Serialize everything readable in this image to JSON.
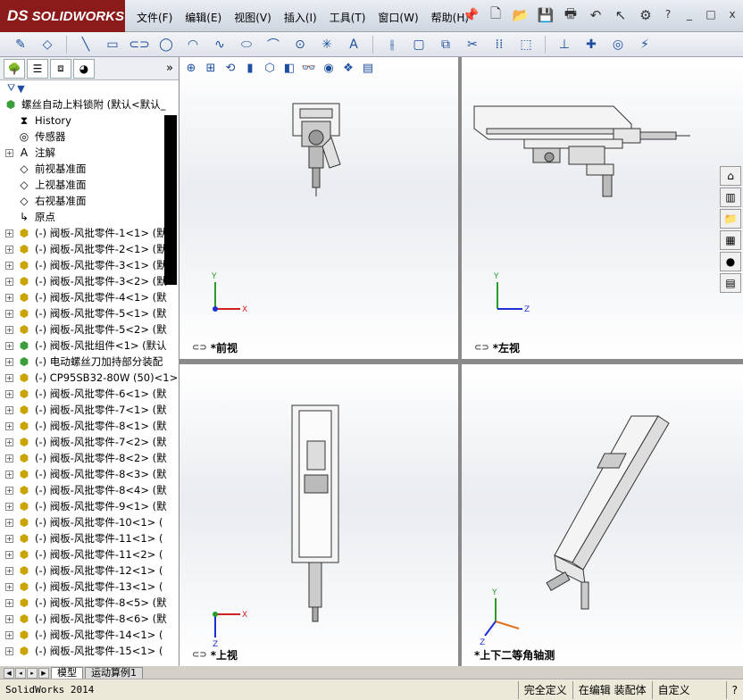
{
  "app": {
    "logo": "SOLIDWORKS",
    "logo_prefix": "DS"
  },
  "menu": [
    "文件(F)",
    "编辑(E)",
    "视图(V)",
    "插入(I)",
    "工具(T)",
    "窗口(W)",
    "帮助(H)"
  ],
  "top_icons": [
    "pin-icon",
    "new-document-icon",
    "open-folder-icon",
    "save-icon",
    "print-icon",
    "undo-icon",
    "select-arrow-icon",
    "options-gear-icon"
  ],
  "window_controls": [
    "?",
    "_",
    "□",
    "x"
  ],
  "toolbar": [
    "sketch",
    "smart-dimension",
    "line",
    "rectangle",
    "slot",
    "circle",
    "arc",
    "spline",
    "ellipse",
    "fillet",
    "point",
    "centerline",
    "text",
    "mirror",
    "convert-entities",
    "offset",
    "trim",
    "linear-pattern",
    "move",
    "relations",
    "repair",
    "quick-snaps"
  ],
  "left_tabs": [
    "featuremanager",
    "propertymanager",
    "configurationmanager",
    "displaymanager"
  ],
  "left_expand": "»",
  "filter_label": "▼",
  "tree": [
    {
      "label": "螺丝自动上料锁附  (默认<默认_",
      "icon": "assembly",
      "expand": false,
      "indent": 0
    },
    {
      "label": "History",
      "icon": "history",
      "expand": false,
      "indent": 1
    },
    {
      "label": "传感器",
      "icon": "sensor",
      "expand": false,
      "indent": 1
    },
    {
      "label": "注解",
      "icon": "annotation",
      "expand": true,
      "indent": 1
    },
    {
      "label": "前视基准面",
      "icon": "plane",
      "expand": false,
      "indent": 1
    },
    {
      "label": "上视基准面",
      "icon": "plane",
      "expand": false,
      "indent": 1
    },
    {
      "label": "右视基准面",
      "icon": "plane",
      "expand": false,
      "indent": 1
    },
    {
      "label": "原点",
      "icon": "origin",
      "expand": false,
      "indent": 1
    },
    {
      "label": "(-) 阀板-风批零件-1<1> (默",
      "icon": "part",
      "expand": true,
      "indent": 1
    },
    {
      "label": "(-) 阀板-风批零件-2<1> (默",
      "icon": "part",
      "expand": true,
      "indent": 1
    },
    {
      "label": "(-) 阀板-风批零件-3<1> (默",
      "icon": "part",
      "expand": true,
      "indent": 1
    },
    {
      "label": "(-) 阀板-风批零件-3<2> (默",
      "icon": "part",
      "expand": true,
      "indent": 1
    },
    {
      "label": "(-) 阀板-风批零件-4<1> (默",
      "icon": "part",
      "expand": true,
      "indent": 1
    },
    {
      "label": "(-) 阀板-风批零件-5<1> (默",
      "icon": "part",
      "expand": true,
      "indent": 1
    },
    {
      "label": "(-) 阀板-风批零件-5<2> (默",
      "icon": "part",
      "expand": true,
      "indent": 1
    },
    {
      "label": "(-) 阀板-风批组件<1> (默认",
      "icon": "assembly",
      "expand": true,
      "indent": 1
    },
    {
      "label": "(-) 电动螺丝刀加持部分装配",
      "icon": "assembly",
      "expand": true,
      "indent": 1
    },
    {
      "label": "(-) CP95SB32-80W (50)<1>",
      "icon": "part",
      "expand": true,
      "indent": 1
    },
    {
      "label": "(-) 阀板-风批零件-6<1> (默",
      "icon": "part",
      "expand": true,
      "indent": 1
    },
    {
      "label": "(-) 阀板-风批零件-7<1> (默",
      "icon": "part",
      "expand": true,
      "indent": 1
    },
    {
      "label": "(-) 阀板-风批零件-8<1> (默",
      "icon": "part",
      "expand": true,
      "indent": 1
    },
    {
      "label": "(-) 阀板-风批零件-7<2> (默",
      "icon": "part",
      "expand": true,
      "indent": 1
    },
    {
      "label": "(-) 阀板-风批零件-8<2> (默",
      "icon": "part",
      "expand": true,
      "indent": 1
    },
    {
      "label": "(-) 阀板-风批零件-8<3> (默",
      "icon": "part",
      "expand": true,
      "indent": 1
    },
    {
      "label": "(-) 阀板-风批零件-8<4> (默",
      "icon": "part",
      "expand": true,
      "indent": 1
    },
    {
      "label": "(-) 阀板-风批零件-9<1> (默",
      "icon": "part",
      "expand": true,
      "indent": 1
    },
    {
      "label": "(-) 阀板-风批零件-10<1> (",
      "icon": "part",
      "expand": true,
      "indent": 1
    },
    {
      "label": "(-) 阀板-风批零件-11<1> (",
      "icon": "part",
      "expand": true,
      "indent": 1
    },
    {
      "label": "(-) 阀板-风批零件-11<2> (",
      "icon": "part",
      "expand": true,
      "indent": 1
    },
    {
      "label": "(-) 阀板-风批零件-12<1> (",
      "icon": "part",
      "expand": true,
      "indent": 1
    },
    {
      "label": "(-) 阀板-风批零件-13<1> (",
      "icon": "part",
      "expand": true,
      "indent": 1
    },
    {
      "label": "(-) 阀板-风批零件-8<5> (默",
      "icon": "part",
      "expand": true,
      "indent": 1
    },
    {
      "label": "(-) 阀板-风批零件-8<6> (默",
      "icon": "part",
      "expand": true,
      "indent": 1
    },
    {
      "label": "(-) 阀板-风批零件-14<1> (",
      "icon": "part",
      "expand": true,
      "indent": 1
    },
    {
      "label": "(-) 阀板-风批零件-15<1> (",
      "icon": "part",
      "expand": true,
      "indent": 1
    }
  ],
  "bottom_tabs": [
    "模型",
    "运动算例1"
  ],
  "status": {
    "app_name": "SolidWorks 2014",
    "fully_defined": "完全定义",
    "editing": "在编辑 装配体",
    "custom": "自定义"
  },
  "heads_up": [
    "zoom-to-fit-icon",
    "zoom-area-icon",
    "previous-view-icon",
    "section-view-icon",
    "view-orientation-icon",
    "display-style-icon",
    "hide-show-icon",
    "edit-appearance-icon",
    "apply-scene-icon",
    "view-settings-icon"
  ],
  "viewports": {
    "front": {
      "label": "*前视"
    },
    "left": {
      "label": "*左视"
    },
    "top": {
      "label": "*上视"
    },
    "iso": {
      "label": "*上下二等角轴测"
    }
  },
  "task_pane": [
    "solidworks-resources-icon",
    "design-library-icon",
    "file-explorer-icon",
    "view-palette-icon",
    "appearances-icon",
    "custom-properties-icon"
  ]
}
